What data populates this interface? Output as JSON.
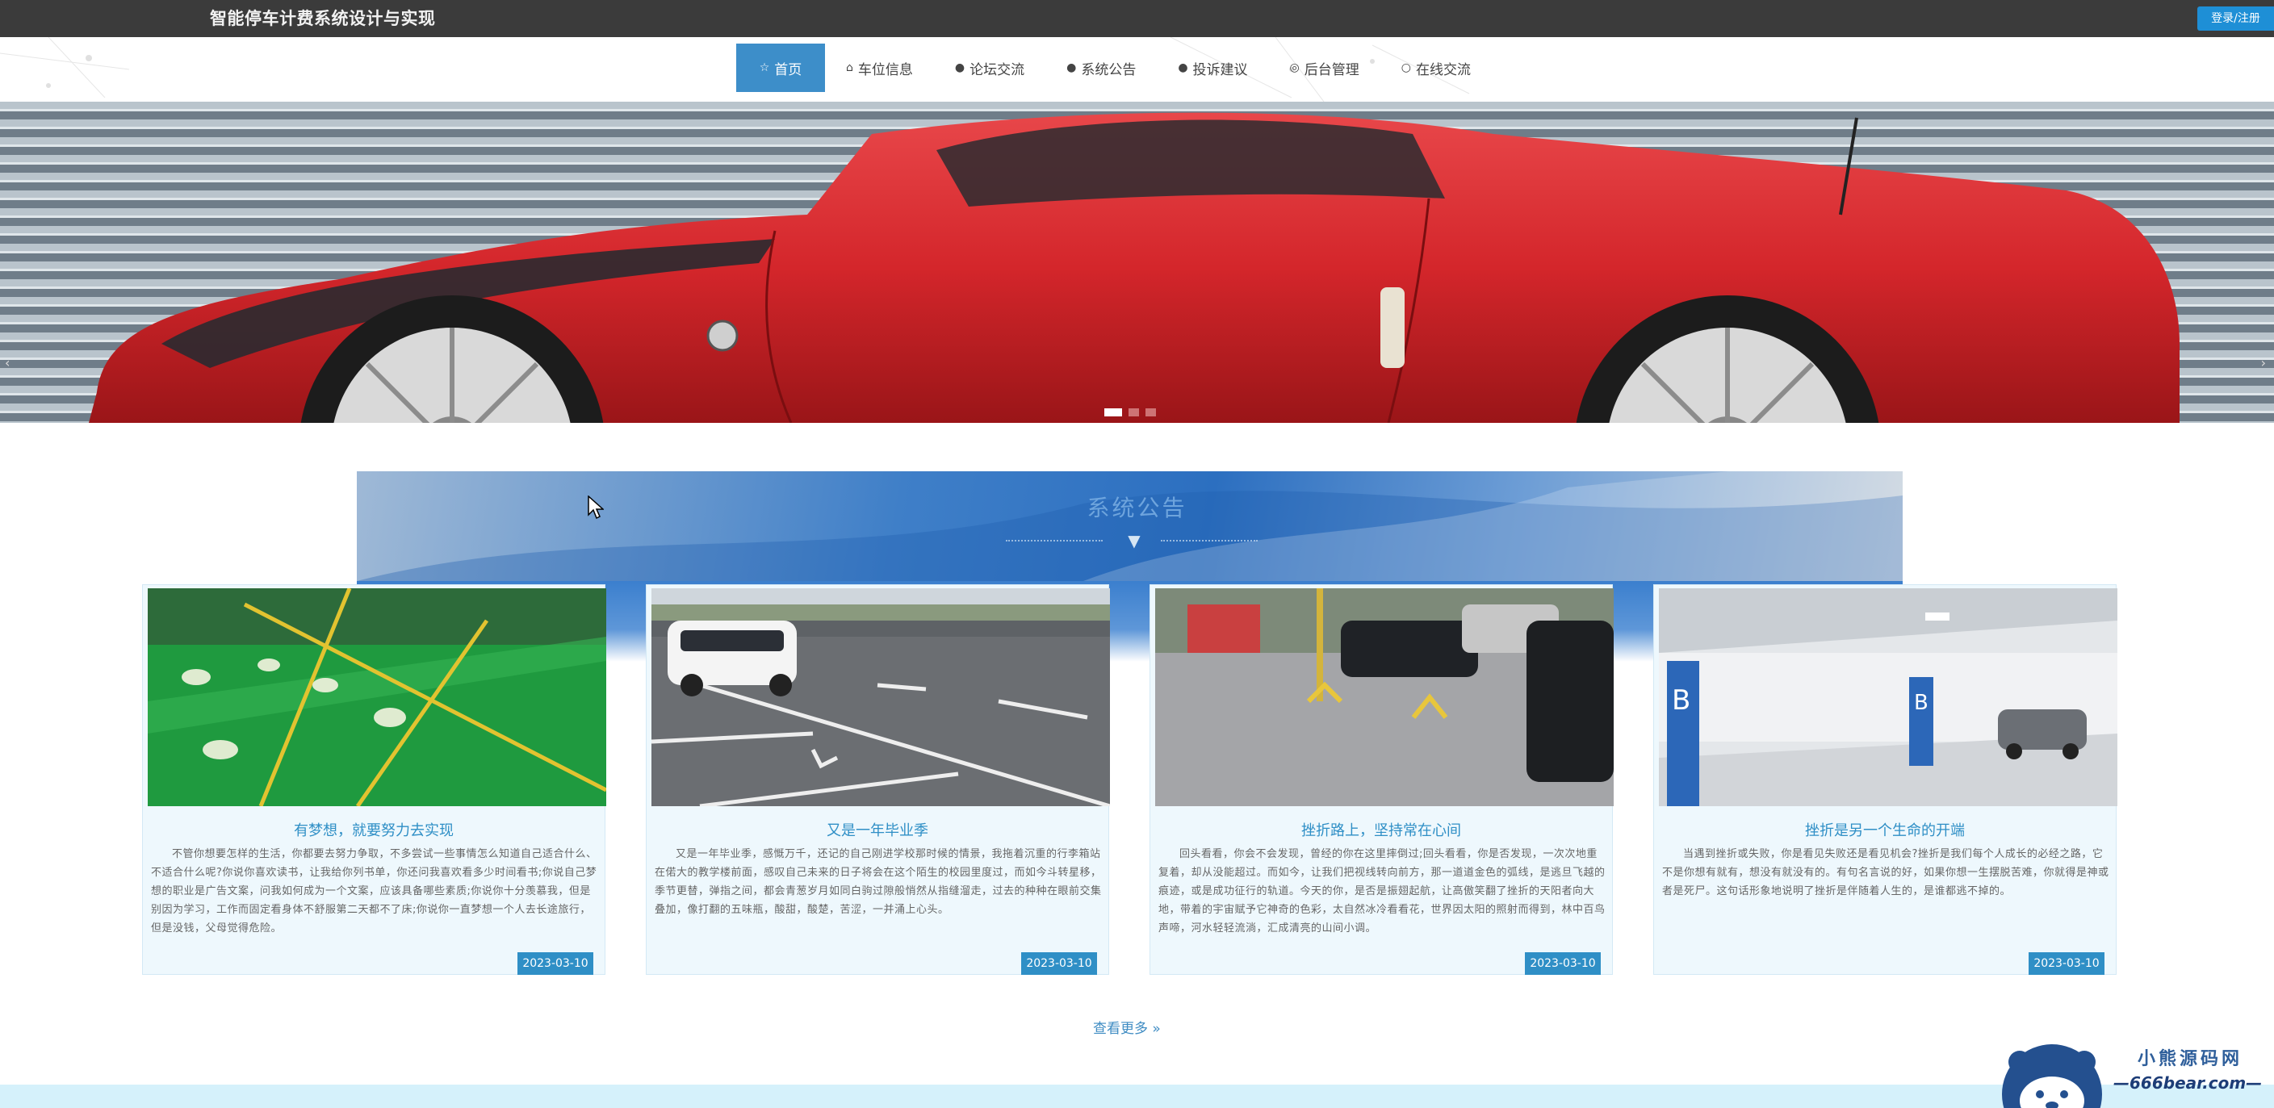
{
  "header": {
    "site_title": "智能停车计费系统设计与实现",
    "login_label": "登录/注册"
  },
  "nav": {
    "items": [
      {
        "label": "首页",
        "icon": "star-icon",
        "active": true
      },
      {
        "label": "车位信息",
        "icon": "home-icon",
        "active": false
      },
      {
        "label": "论坛交流",
        "icon": "info-icon",
        "active": false
      },
      {
        "label": "系统公告",
        "icon": "question-icon",
        "active": false
      },
      {
        "label": "投诉建议",
        "icon": "info-icon",
        "active": false
      },
      {
        "label": "后台管理",
        "icon": "settings-icon",
        "active": false
      },
      {
        "label": "在线交流",
        "icon": "chat-icon",
        "active": false
      }
    ]
  },
  "banner": {
    "slide_count": 3,
    "active_slide": 1
  },
  "notice": {
    "section_title": "系统公告",
    "cards": [
      {
        "title": "有梦想，就要努力去实现",
        "text": "不管你想要怎样的生活，你都要去努力争取，不多尝试一些事情怎么知道自己适合什么、不适合什么呢?你说你喜欢读书，让我给你列书单，你还问我喜欢看多少时间看书;你说自己梦想的职业是广告文案，问我如何成为一个文案，应该具备哪些素质;你说你十分羡慕我，但是别因为学习，工作而固定看身体不舒服第二天都不了床;你说你一直梦想一个人去长途旅行，但是没钱，父母觉得危险。",
        "date": "2023-03-10"
      },
      {
        "title": "又是一年毕业季",
        "text": "又是一年毕业季，感慨万千，还记的自己刚进学校那时候的情景，我拖着沉重的行李箱站在偌大的教学楼前面，感叹自己未来的日子将会在这个陌生的校园里度过，而如今斗转星移，季节更替，弹指之间，都会青葱岁月如同白驹过隙般悄然从指缝溜走，过去的种种在眼前交集叠加，像打翻的五味瓶，酸甜，酸楚，苦涩，一并涌上心头。",
        "date": "2023-03-10"
      },
      {
        "title": "挫折路上，坚持常在心间",
        "text": "回头看看，你会不会发现，曾经的你在这里摔倒过;回头看看，你是否发现，一次次地重复着，却从没能超过。而如今，让我们把视线转向前方，那一道道金色的弧线，是逃旦飞越的痕迹，或是成功征行的轨道。今天的你，是否是振翅起航，让高傲笑翻了挫折的天阳者向大地，带着的宇宙赋予它神奇的色彩，太自然冰冷看看花，世界因太阳的照射而得到，林中百鸟声啼，河水轻轻流淌，汇成清亮的山间小调。",
        "date": "2023-03-10"
      },
      {
        "title": "挫折是另一个生命的开端",
        "text": "当遇到挫折或失败，你是看见失败还是看见机会?挫折是我们每个人成长的必经之路，它不是你想有就有，想没有就没有的。有句名言说的好，如果你想一生摆脱苦难，你就得是神或者是死尸。这句话形象地说明了挫折是伴随着人生的，是谁都逃不掉的。",
        "date": "2023-03-10"
      }
    ],
    "more_label": "查看更多 »"
  },
  "watermark": {
    "top": "小熊源码网",
    "bottom": "—666bear.com—"
  }
}
